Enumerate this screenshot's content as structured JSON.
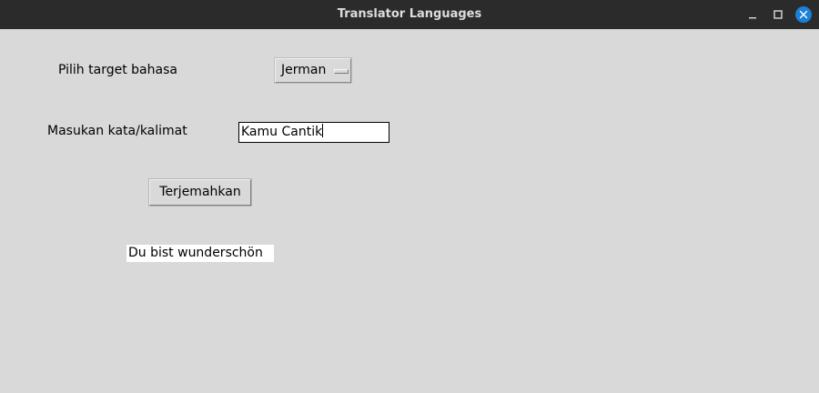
{
  "window": {
    "title": "Translator Languages",
    "controls": {
      "minimize_icon": "minimize-icon",
      "maximize_icon": "maximize-icon",
      "close_icon": "close-icon"
    },
    "colors": {
      "titlebar": "#2b2b2b",
      "background": "#d9d9d9",
      "close_button": "#1c7fd8"
    }
  },
  "form": {
    "target_label": "Pilih target bahasa",
    "target_language": "Jerman",
    "input_label": "Masukan kata/kalimat",
    "input_value": "Kamu Cantik",
    "translate_button": "Terjemahkan",
    "output_value": "Du bist wunderschön"
  }
}
